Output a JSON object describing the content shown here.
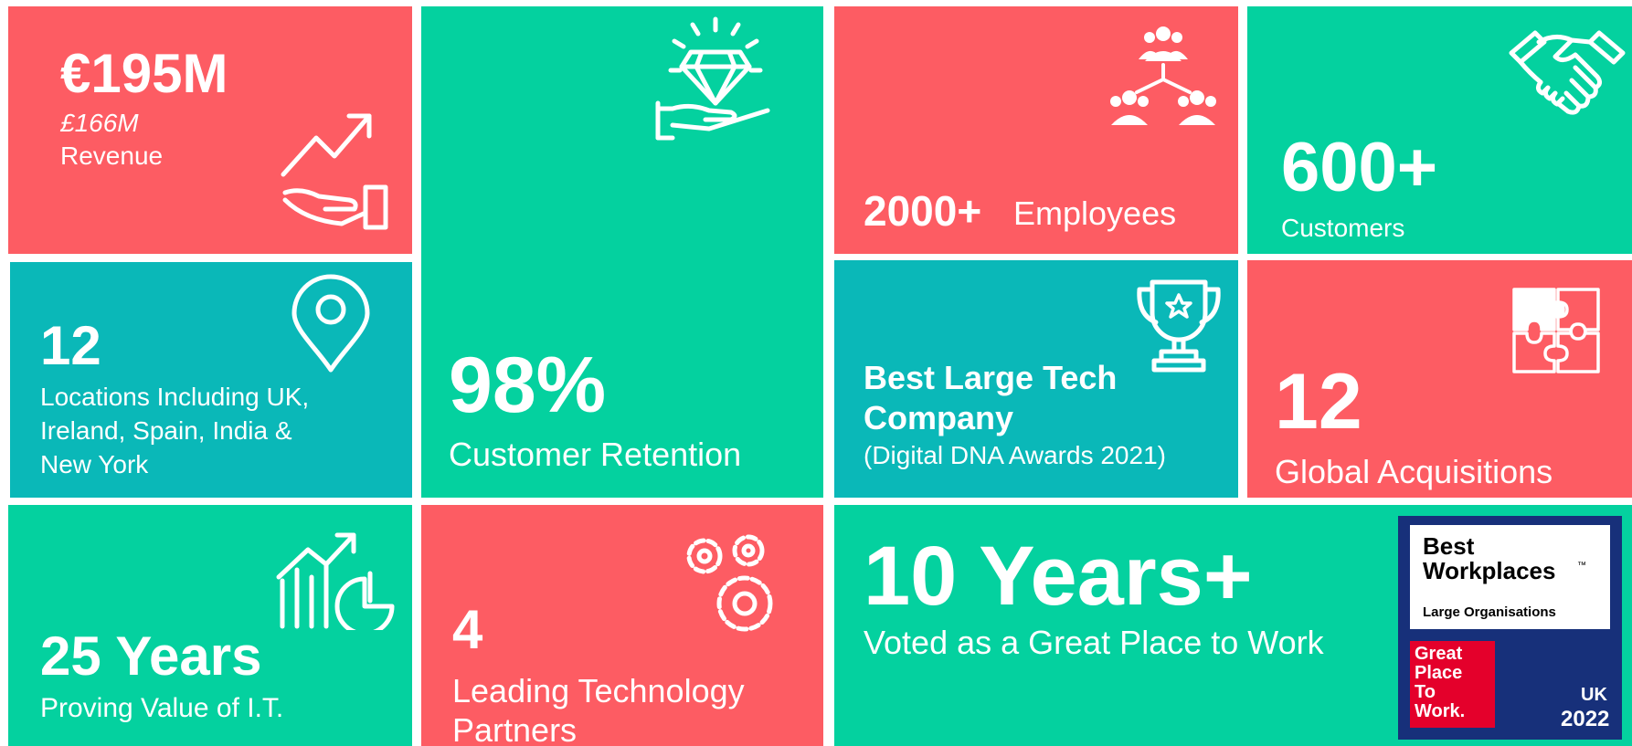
{
  "revenue": {
    "value": "€195M",
    "sub": "£166M",
    "label": "Revenue",
    "icon": "growth-hand-icon"
  },
  "locations": {
    "value": "12",
    "lines": [
      "Locations Including UK,",
      "Ireland, Spain, India &",
      "New York"
    ],
    "icon": "map-pin-icon"
  },
  "retention": {
    "value": "98%",
    "label": "Customer Retention",
    "icon": "diamond-hand-icon"
  },
  "employees": {
    "value": "2000+",
    "label": "Employees",
    "icon": "team-network-icon"
  },
  "customers": {
    "value": "600+",
    "label": "Customers",
    "icon": "handshake-icon"
  },
  "award": {
    "line1": "Best Large Tech",
    "line2": "Company",
    "sub": "(Digital DNA Awards 2021)",
    "icon": "trophy-icon"
  },
  "acquisitions": {
    "value": "12",
    "label": "Global Acquisitions",
    "icon": "puzzle-icon"
  },
  "years": {
    "value": "25 Years",
    "label": "Proving Value of I.T.",
    "icon": "chart-growth-icon"
  },
  "partners": {
    "value": "4",
    "lines": [
      "Leading Technology",
      "Partners"
    ],
    "icon": "gears-icon"
  },
  "workplace": {
    "value": "10 Years+",
    "label": "Voted as a Great Place to Work"
  },
  "badge": {
    "title1": "Best",
    "title2": "Workplaces",
    "tm": "™",
    "category": "Large Organisations",
    "gp": [
      "Great",
      "Place",
      "To",
      "Work."
    ],
    "country": "UK",
    "year": "2022"
  },
  "colors": {
    "red": "#fd5c63",
    "green": "#04d19f",
    "teal": "#0ab8b8",
    "badge_navy": "#17307a",
    "gptw_red": "#e4002b"
  }
}
